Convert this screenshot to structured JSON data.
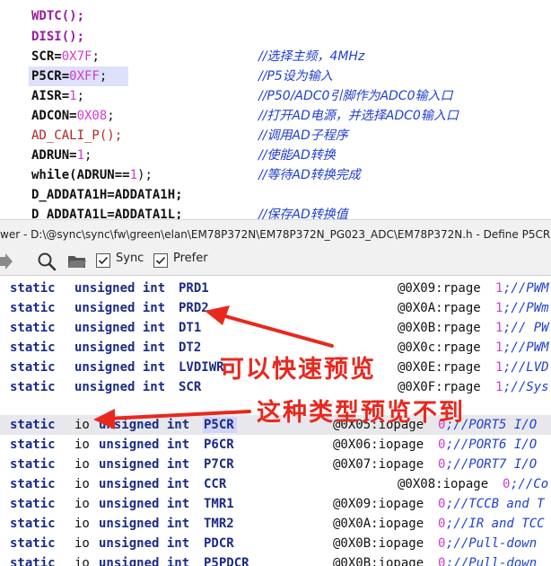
{
  "editor": {
    "lines": [
      {
        "code": "WDTC();",
        "comment": ""
      },
      {
        "code": "DISI();",
        "comment": ""
      },
      {
        "code_a": "SCR=",
        "code_b": "0X7F",
        "code_c": ";",
        "comment": "//选择主频，4MHz"
      },
      {
        "code_a": "P5CR=",
        "code_b": "0XFF",
        "code_c": ";",
        "comment": "//P5设为输入"
      },
      {
        "code_a": "AISR=",
        "code_b": "1",
        "code_c": ";",
        "comment": "//P50/ADC0引脚作为ADC0输入口"
      },
      {
        "code_a": "ADCON=",
        "code_b": "0X08",
        "code_c": ";",
        "comment": "//打开AD电源，并选择ADC0输入口"
      },
      {
        "code": "AD_CALI_P();",
        "comment": "//调用AD子程序"
      },
      {
        "code_a": "ADRUN=",
        "code_b": "1",
        "code_c": ";",
        "comment": "//使能AD转换"
      },
      {
        "code_a": "while(ADRUN==",
        "code_b": "1",
        "code_c": ");",
        "comment": "//等待AD转换完成"
      },
      {
        "code": "D_ADDATA1H=ADDATA1H;",
        "comment": ""
      },
      {
        "code": "D_ADDATA1L=ADDATA1L;",
        "comment": "//保存AD转换值"
      }
    ]
  },
  "titlebar": {
    "text": "wer - D:\\@sync\\sync\\fw\\green\\elan\\EM78P372N\\EM78P372N_PG023_ADC\\EM78P372N.h - Define P5CR"
  },
  "toolbar": {
    "icons": [
      "arrow-right-icon",
      "search-icon",
      "folder-icon"
    ],
    "sync_label": "Sync",
    "sync_checked": true,
    "prefer_label": "Prefer",
    "prefer_checked": true
  },
  "preview": {
    "rows_rpage": [
      {
        "kw": "static",
        "type": "unsigned int",
        "name": "PRD1",
        "addr": "@0X09:rpage",
        "num": "1",
        "tail": ";//PWM"
      },
      {
        "kw": "static",
        "type": "unsigned int",
        "name": "PRD2",
        "addr": "@0X0A:rpage",
        "num": "1",
        "tail": ";//PWm"
      },
      {
        "kw": "static",
        "type": "unsigned int",
        "name": "DT1",
        "addr": "@0X0B:rpage",
        "num": "1",
        "tail": ";// PW"
      },
      {
        "kw": "static",
        "type": "unsigned int",
        "name": "DT2",
        "addr": "@0X0c:rpage",
        "num": "1",
        "tail": ";//PWM"
      },
      {
        "kw": "static",
        "type": "unsigned int",
        "name": "LVDIWR",
        "addr": "@0X0E:rpage",
        "num": "1",
        "tail": ";//LVD"
      },
      {
        "kw": "static",
        "type": "unsigned int",
        "name": "SCR",
        "addr": "@0X0F:rpage",
        "num": "1",
        "tail": ";//Sys"
      }
    ],
    "rows_iopage": [
      {
        "kw": "static",
        "io": "io",
        "type": "unsigned int",
        "name": "P5CR",
        "addr": "@0X05:iopage",
        "num": "0",
        "tail": ";//PORT5 I/O"
      },
      {
        "kw": "static",
        "io": "io",
        "type": "unsigned int",
        "name": "P6CR",
        "addr": "@0X06:iopage",
        "num": "0",
        "tail": ";//PORT6 I/O"
      },
      {
        "kw": "static",
        "io": "io",
        "type": "unsigned int",
        "name": "P7CR",
        "addr": "@0X07:iopage",
        "num": "0",
        "tail": ";//PORT7 I/O"
      },
      {
        "kw": "static",
        "io": "io",
        "type": "unsigned int",
        "name": "CCR",
        "addr": "@0X08:iopage",
        "num": "0",
        "tail": ";//Co"
      },
      {
        "kw": "static",
        "io": "io",
        "type": "unsigned int",
        "name": "TMR1",
        "addr": "@0X09:iopage",
        "num": "0",
        "tail": ";//TCCB and T"
      },
      {
        "kw": "static",
        "io": "io",
        "type": "unsigned int",
        "name": "TMR2",
        "addr": "@0X0A:iopage",
        "num": "0",
        "tail": ";//IR and TCC"
      },
      {
        "kw": "static",
        "io": "io",
        "type": "unsigned int",
        "name": "PDCR",
        "addr": "@0X0B:iopage",
        "num": "0",
        "tail": ";//Pull-down"
      },
      {
        "kw": "static",
        "io": "io",
        "type": "unsigned int",
        "name": "P5PDCR",
        "addr": "@0X0B:iopage",
        "num": "0",
        "tail": ";//Pull-down"
      }
    ]
  },
  "annotations": {
    "can_preview": "可以快速预览",
    "cannot_preview": "这种类型预览不到",
    "color": "#e8281e"
  }
}
